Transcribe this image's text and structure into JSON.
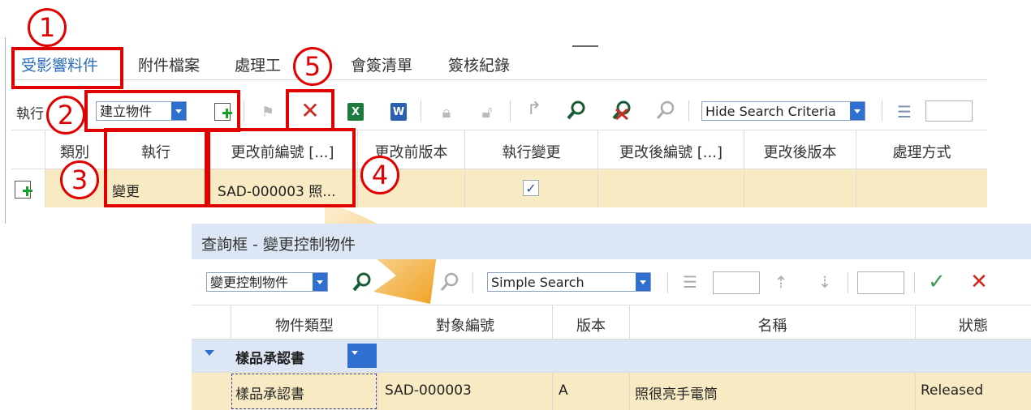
{
  "annotations": {
    "c1": "1",
    "c2": "2",
    "c3": "3",
    "c4": "4",
    "c5": "5"
  },
  "tabs": [
    "受影響料件",
    "附件檔案",
    "處理工",
    "會簽清單",
    "簽核紀錄"
  ],
  "toolbar": {
    "row_label": "執行",
    "create_combo": "建立物件",
    "search_combo": "Hide Search Criteria"
  },
  "grid": {
    "headers": [
      "類別",
      "執行",
      "更改前編號 [...]",
      "更改前版本",
      "執行變更",
      "更改後編號 [...]",
      "更改後版本",
      "處理方式"
    ],
    "row": {
      "action": "變更",
      "before_number": "SAD-000003 照..."
    }
  },
  "dialog": {
    "title": "查詢框 - 變更控制物件",
    "type_combo": "變更控制物件",
    "search_combo": "Simple Search",
    "headers": [
      "物件類型",
      "對象編號",
      "版本",
      "名稱",
      "狀態"
    ],
    "group_label": "樣品承認書",
    "row": {
      "type": "樣品承認書",
      "number": "SAD-000003",
      "version": "A",
      "name": "照很亮手電筒",
      "status": "Released"
    }
  },
  "colors": {
    "accent": "#2a6ebd",
    "highlight": "#e00000",
    "selected_row": "#f8ebc4",
    "dialog_header": "#dde6f4",
    "arrow": "#f4a020"
  }
}
